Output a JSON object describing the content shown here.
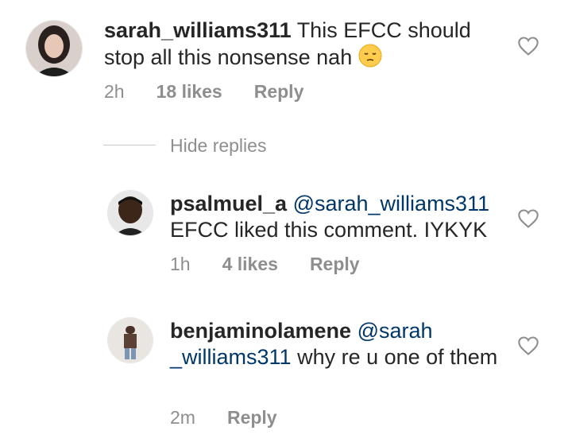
{
  "comments": [
    {
      "username": "sarah_williams311",
      "text": "This EFCC should stop all this nonsense nah",
      "emoji": "pensive-face",
      "time": "2h",
      "likes": "18 likes",
      "reply": "Reply"
    }
  ],
  "hide_replies": "Hide replies",
  "replies": [
    {
      "username": "psalmuel_a",
      "mention": "@sarah_williams311",
      "text": "EFCC liked this comment. IYKYK",
      "time": "1h",
      "likes": "4 likes",
      "reply": "Reply"
    },
    {
      "username": "benjaminolamene",
      "mention_line1": "@sarah",
      "mention_line2": "_williams311",
      "text": "why re u one of them",
      "time": "2m",
      "reply": "Reply"
    }
  ],
  "colors": {
    "text": "#262626",
    "meta": "#8e8e8e",
    "mention": "#00376b"
  },
  "icons": {
    "like": "heart-outline-icon"
  }
}
